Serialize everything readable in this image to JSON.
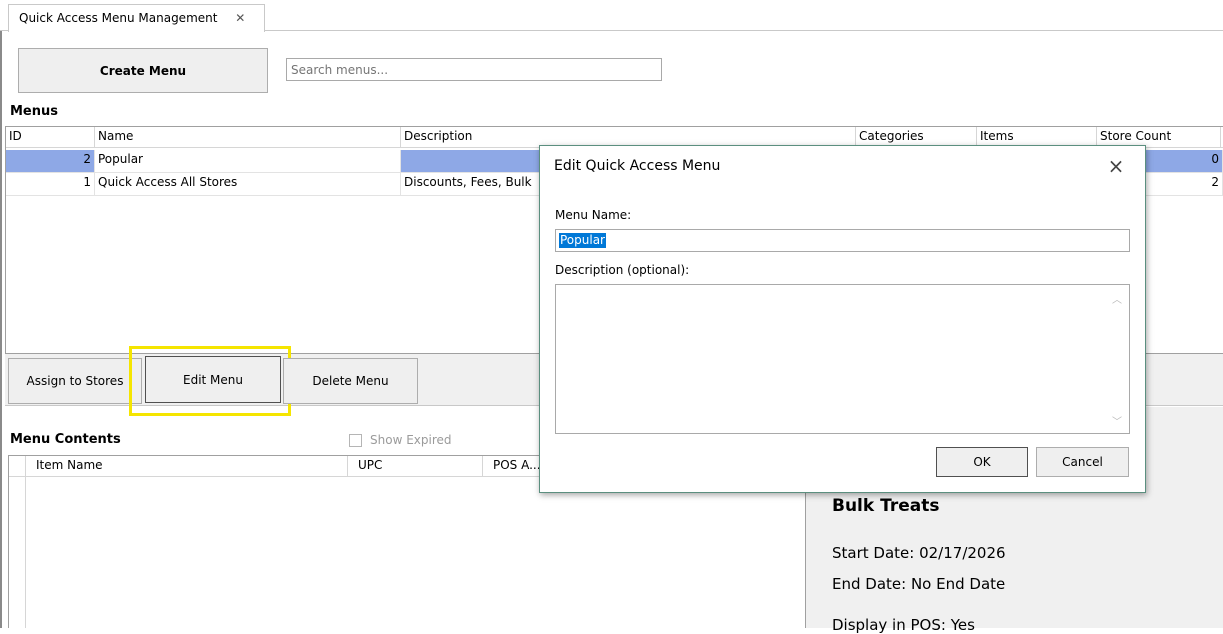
{
  "tab": {
    "title": "Quick Access Menu Management",
    "close_glyph": "✕"
  },
  "toolbar": {
    "create_menu_label": "Create Menu",
    "search_placeholder": "Search menus..."
  },
  "menus": {
    "section_title": "Menus",
    "columns": [
      "ID",
      "Name",
      "Description",
      "Categories",
      "Items",
      "Store Count"
    ],
    "rows": [
      {
        "id": "2",
        "name": "Popular",
        "description": "",
        "store_count": "0",
        "selected": true
      },
      {
        "id": "1",
        "name": "Quick Access All Stores",
        "description": "Discounts, Fees, Bulk",
        "store_count": "2",
        "selected": false
      }
    ]
  },
  "actions": {
    "assign_label": "Assign to Stores",
    "edit_label": "Edit Menu",
    "delete_label": "Delete Menu",
    "highlight_color": "#f5e500"
  },
  "contents": {
    "section_title": "Menu Contents",
    "show_expired_label": "Show Expired",
    "columns": [
      "Item Name",
      "UPC",
      "POS A..."
    ]
  },
  "details": {
    "title": "Bulk Treats",
    "start_date": "Start Date: 02/17/2026",
    "end_date": "End Date: No End Date",
    "display_in_pos": "Display in POS: Yes"
  },
  "dialog": {
    "title": "Edit Quick Access Menu",
    "close_glyph": "×",
    "name_label": "Menu Name:",
    "name_value": "Popular",
    "description_label": "Description (optional):",
    "description_value": "",
    "ok_label": "OK",
    "cancel_label": "Cancel"
  },
  "colors": {
    "selection": "#8ea8e6",
    "text_selection": "#0078d7"
  }
}
